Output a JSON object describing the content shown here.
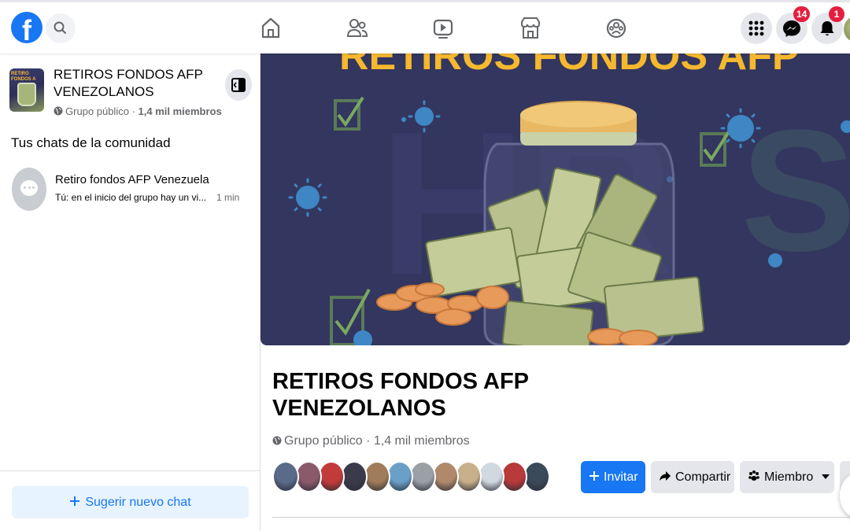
{
  "topbar": {
    "logo_letter": "f",
    "messenger_badge": "14",
    "notifications_badge": "1"
  },
  "sidebar": {
    "group_thumb_text": "RETIRO FONDOS A",
    "group_name": "RETIROS FONDOS AFP VENEZOLANOS",
    "group_privacy": "Grupo público",
    "group_separator": " · ",
    "group_members": "1,4 mil miembros",
    "section_title": "Tus chats de la comunidad",
    "chat": {
      "name": "Retiro fondos AFP Venezuela",
      "preview": "Tú: en el inicio del grupo hay un vi...",
      "time": "1 min"
    },
    "suggest_label": "Sugerir nuevo chat"
  },
  "main": {
    "cover_title": "RETIROS FONDOS AFP",
    "title": "RETIROS FONDOS AFP VENEZOLANOS",
    "privacy": "Grupo público",
    "separator": " · ",
    "members": "1,4 mil miembros",
    "invite_label": "Invitar",
    "share_label": "Compartir",
    "member_label": "Miembro"
  },
  "colors": {
    "brand": "#1877f2",
    "badge": "#e41e3f",
    "cover_bg": "#33365e",
    "cover_title": "#f5b82e",
    "virus": "#3f86c4"
  },
  "member_avatar_colors": [
    "#5a6b8a",
    "#8a5a6b",
    "#c23b3b",
    "#3a3a4a",
    "#a07c5a",
    "#6aa0c8",
    "#9aa0a6",
    "#b0896a",
    "#c8b08a",
    "#d0d8e0",
    "#b83a3a",
    "#3a4a5a"
  ]
}
